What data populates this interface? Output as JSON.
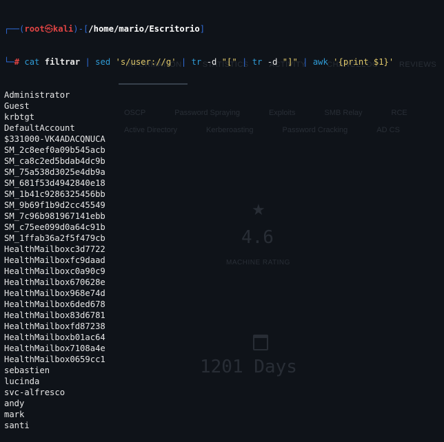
{
  "background_page": {
    "tabs": [
      "INFORMATION",
      "STATISTICS",
      "ACTIVITY",
      "CHANGELOG",
      "REVIEWS"
    ],
    "tags_row_1": [
      "OSCP",
      "Password Spraying",
      "Exploits",
      "SMB Relay",
      "RCE"
    ],
    "tags_row_2": [
      "Active Directory",
      "Kerberoasting",
      "Password Cracking",
      "AD CS"
    ],
    "rating_value": "4.6",
    "rating_label": "MACHINE RATING",
    "days_value": "1201 Days"
  },
  "terminal": {
    "prompt": {
      "corner_top": "┌──(",
      "user": "root",
      "skull": "㉿",
      "host": "kali",
      "mid": ")-[",
      "path": "/home/mario/Escritorio",
      "end": "]",
      "corner_bottom": "└─",
      "hash": "#"
    },
    "command": {
      "cat": "cat",
      "file": "filtrar",
      "pipe1": "|",
      "sed": "sed",
      "sed_arg": "'s/user://g'",
      "pipe2": "|",
      "tr1": "tr",
      "tr1_flag": "-d",
      "tr1_arg": "\"[\"",
      "pipe3": "|",
      "tr2": "tr",
      "tr2_flag": "-d",
      "tr2_arg": "\"]\"",
      "pipe4": "|",
      "awk": "awk",
      "awk_arg": "'{print $1}'"
    },
    "output": [
      "Administrator",
      "Guest",
      "krbtgt",
      "DefaultAccount",
      "$331000-VK4ADACQNUCA",
      "SM_2c8eef0a09b545acb",
      "SM_ca8c2ed5bdab4dc9b",
      "SM_75a538d3025e4db9a",
      "SM_681f53d4942840e18",
      "SM_1b41c9286325456bb",
      "SM_9b69f1b9d2cc45549",
      "SM_7c96b981967141ebb",
      "SM_c75ee099d0a64c91b",
      "SM_1ffab36a2f5f479cb",
      "HealthMailboxc3d7722",
      "HealthMailboxfc9daad",
      "HealthMailboxc0a90c9",
      "HealthMailbox670628e",
      "HealthMailbox968e74d",
      "HealthMailbox6ded678",
      "HealthMailbox83d6781",
      "HealthMailboxfd87238",
      "HealthMailboxb01ac64",
      "HealthMailbox7108a4e",
      "HealthMailbox0659cc1",
      "sebastien",
      "lucinda",
      "svc-alfresco",
      "andy",
      "mark",
      "santi"
    ]
  }
}
